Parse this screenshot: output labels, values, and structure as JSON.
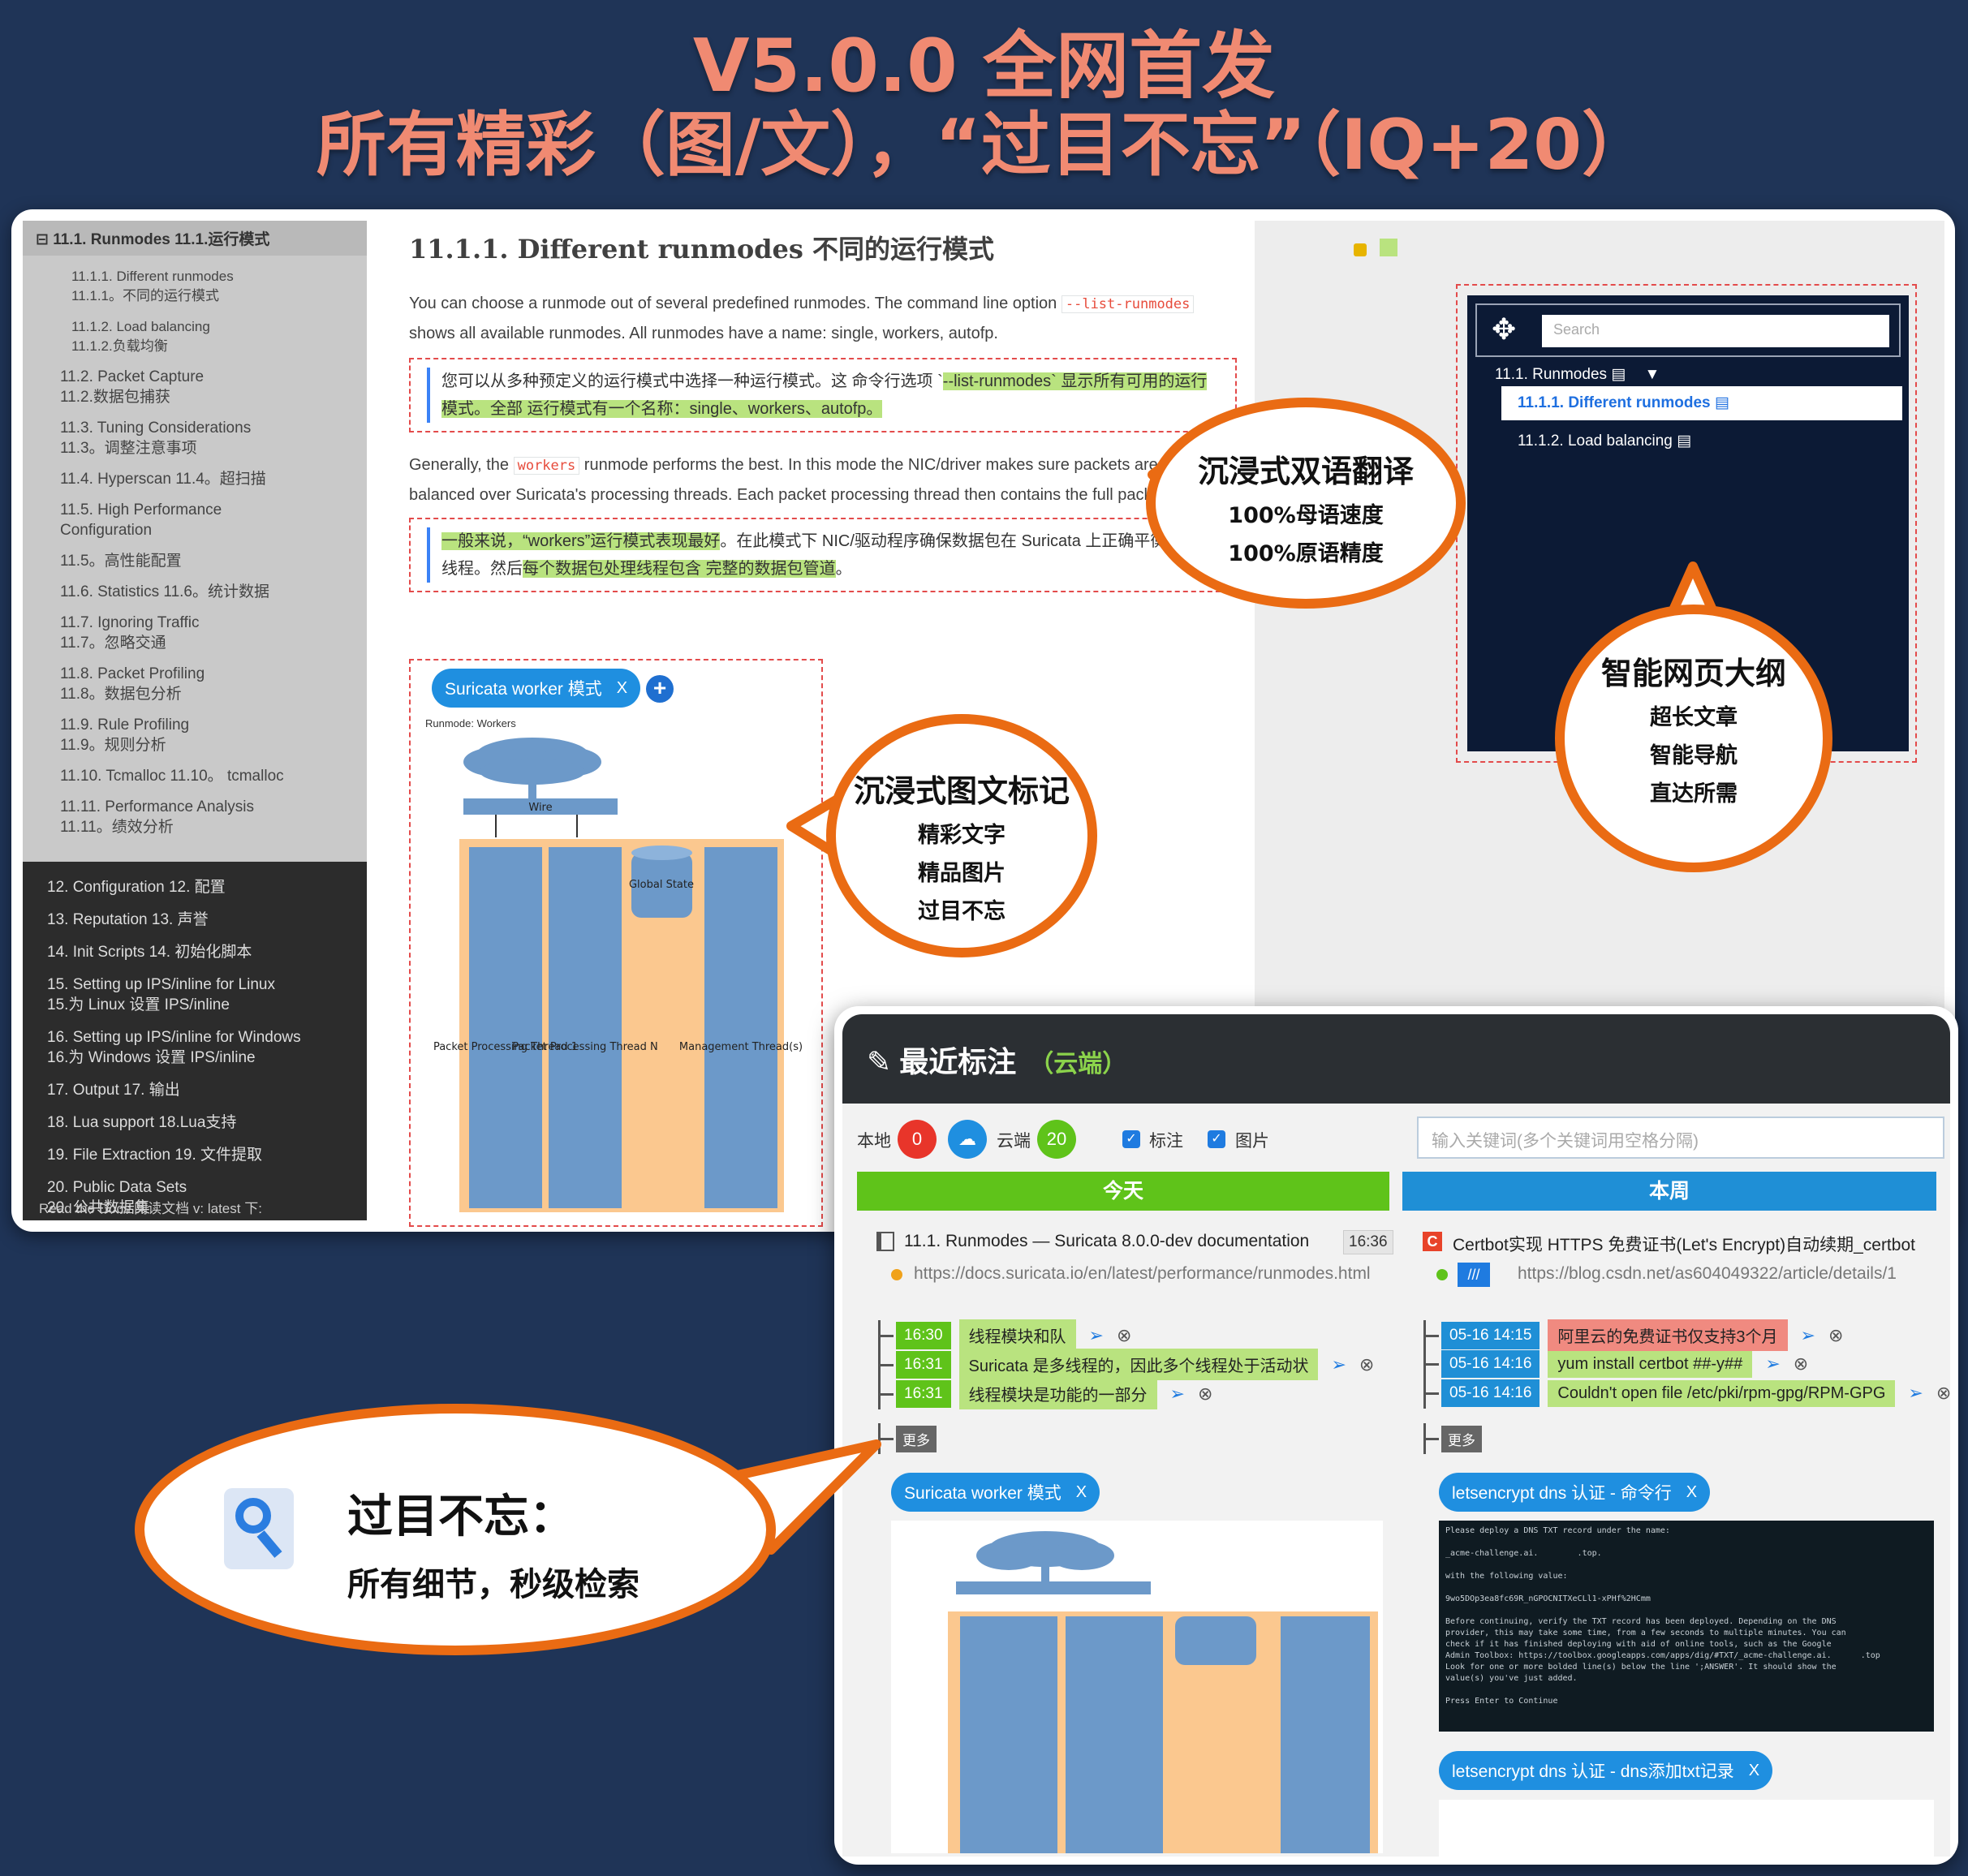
{
  "headline": {
    "line1": "V5.0.0  全网首发",
    "line2": "所有精彩（图/文），“过目不忘”（IQ+20）"
  },
  "sidebar": {
    "current": "⊟ 11.1. Runmodes  11.1.运行模式",
    "sub_items": [
      [
        "11.1.1. Different runmodes",
        "11.1.1。不同的运行模式"
      ],
      [
        "11.1.2. Load balancing",
        "11.1.2.负载均衡"
      ]
    ],
    "items": [
      [
        "11.2. Packet Capture",
        "11.2.数据包捕获"
      ],
      [
        "11.3. Tuning Considerations",
        "11.3。调整注意事项"
      ],
      [
        "11.4. Hyperscan  11.4。超扫描",
        ""
      ],
      [
        "11.5. High Performance",
        "Configuration"
      ],
      [
        "11.5。高性能配置",
        ""
      ],
      [
        "11.6. Statistics  11.6。统计数据",
        ""
      ],
      [
        "11.7. Ignoring Traffic",
        "11.7。忽略交通"
      ],
      [
        "11.8. Packet Profiling",
        "11.8。数据包分析"
      ],
      [
        "11.9. Rule Profiling",
        "11.9。规则分析"
      ],
      [
        "11.10. Tcmalloc  11.10。 tcmalloc",
        ""
      ],
      [
        "11.11. Performance Analysis",
        "11.11。绩效分析"
      ]
    ],
    "dark_items": [
      [
        "12. Configuration  12. 配置",
        ""
      ],
      [
        "13. Reputation  13. 声誉",
        ""
      ],
      [
        "14. Init Scripts  14. 初始化脚本",
        ""
      ],
      [
        "15. Setting up IPS/inline for Linux",
        "15.为 Linux 设置 IPS/inline"
      ],
      [
        "16. Setting up IPS/inline for Windows",
        "16.为 Windows 设置 IPS/inline"
      ],
      [
        "17. Output  17. 输出",
        ""
      ],
      [
        "18. Lua support  18.Lua支持",
        ""
      ],
      [
        "19. File Extraction  19. 文件提取",
        ""
      ],
      [
        "20. Public Data Sets",
        "20. 公共数据集"
      ]
    ],
    "footer": "Read the Docs  阅读文档   v: latest   下:"
  },
  "doc": {
    "title": "11.1.1. Different runmodes 不同的运行模式",
    "p1_a": "You can choose a runmode out of several predefined runmodes. The command line option ",
    "p1_code": "--list-runmodes",
    "p1_b": " shows all available runmodes. All runmodes have a name: single, workers, autofp.",
    "t1_a": "您可以从多种预定义的运行模式中选择一种运行模式。这 命令行选项 `",
    "t1_hl": "--list-runmodes` 显示所有可用的运行模式。全部 运行模式有一个名称：single、workers、autofp。",
    "p2_a": "Generally, the ",
    "p2_code": "workers",
    "p2_b": " runmode performs the best. In this mode the NIC/driver makes sure packets are properly balanced over Suricata's processing threads. Each packet processing thread then contains the full packet pipeline.",
    "t2_hl1": "一般来说，“workers”运行模式表现最好",
    "t2_a": "。在此模式下 NIC/驱动程序确保数据包在 Suricata 上正确平衡 处理线程。然后",
    "t2_hl2": "每个数据包处理线程包含 完整的数据包管道",
    "t2_b": "。"
  },
  "diagram": {
    "tag": "Suricata worker 模式",
    "tag_close": "X",
    "plus": "+",
    "runmode_label": "Runmode: Workers",
    "wire": "Wire",
    "global_state": "Global State",
    "thread1": "Packet Processing Thread 1",
    "threadN": "Packet Processing Thread N",
    "mgmt": "Management Thread(s)"
  },
  "outline": {
    "search_placeholder": "Search",
    "item1": "11.1. Runmodes",
    "item2": "11.1.1. Different runmodes",
    "item3": "11.1.2. Load balancing"
  },
  "bubbles": {
    "translate": {
      "title": "沉浸式双语翻译",
      "l1": "100%母语速度",
      "l2": "100%原语精度"
    },
    "outline": {
      "title": "智能网页大纲",
      "l1": "超长文章",
      "l2": "智能导航",
      "l3": "直达所需"
    },
    "mark": {
      "title": "沉浸式图文标记",
      "l1": "精彩文字",
      "l2": "精品图片",
      "l3": "过目不忘"
    },
    "remember": {
      "title": "过目不忘：",
      "l1": "所有细节，秒级检索"
    }
  },
  "recent": {
    "title": "最近标注",
    "cloud_label": "（云端）",
    "local_label": "本地",
    "local_count": "0",
    "cloud_count_label": "云端",
    "cloud_count": "20",
    "filter_mark": "标注",
    "filter_image": "图片",
    "search_placeholder": "输入关键词(多个关键词用空格分隔)",
    "today": "今天",
    "week": "本周",
    "left": {
      "title": "11.1. Runmodes — Suricata 8.0.0-dev documentation",
      "time_badge": "16:36",
      "url": "https://docs.suricata.io/en/latest/performance/runmodes.html",
      "rows": [
        {
          "time": "16:30",
          "text": "线程模块和队"
        },
        {
          "time": "16:31",
          "text": "Suricata 是多线程的，因此多个线程处于活动状"
        },
        {
          "time": "16:31",
          "text": "线程模块是功能的一部分"
        }
      ],
      "more": "更多",
      "tag": "Suricata worker 模式"
    },
    "right": {
      "title": "Certbot实现 HTTPS 免费证书(Let's Encrypt)自动续期_certbot",
      "url": "https://blog.csdn.net/as604049322/article/details/1",
      "rows": [
        {
          "time": "05-16 14:15",
          "text": "阿里云的免费证书仅支持3个月"
        },
        {
          "time": "05-16 14:16",
          "text": "yum install certbot ##-y##"
        },
        {
          "time": "05-16 14:16",
          "text": "Couldn't open file /etc/pki/rpm-gpg/RPM-GPG"
        }
      ],
      "more": "更多",
      "tag1": "letsencrypt dns 认证 - 命令行",
      "tag2": "letsencrypt dns 认证 - dns添加txt记录",
      "terminal": "Please deploy a DNS TXT record under the name:\n\n_acme-challenge.ai.        .top.\n\nwith the following value:\n\n9wo5DOp3ea8fc69R_nGPOCNITXeCLl1-xPHf%2HCmm\n\nBefore continuing, verify the TXT record has been deployed. Depending on the DNS\nprovider, this may take some time, from a few seconds to multiple minutes. You can\ncheck if it has finished deploying with aid of online tools, such as the Google\nAdmin Toolbox: https://toolbox.googleapps.com/apps/dig/#TXT/_acme-challenge.ai.      .top\nLook for one or more bolded line(s) below the line ';ANSWER'. It should show the\nvalue(s) you've just added.\n\nPress Enter to Continue"
    }
  },
  "colors": {
    "accent_orange": "#ea6b13",
    "headline": "#f08a72",
    "bg": "#1f3457",
    "green": "#5fc31a",
    "blue": "#1f8fd6"
  }
}
